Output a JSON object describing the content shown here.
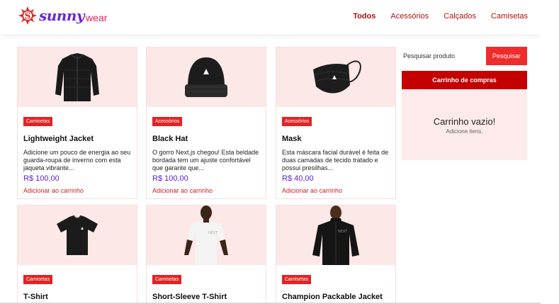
{
  "brand": {
    "name": "sunny",
    "suffix": "wear",
    "badge_letter": "S"
  },
  "nav": [
    {
      "label": "Todos",
      "active": true
    },
    {
      "label": "Acessórios",
      "active": false
    },
    {
      "label": "Calçados",
      "active": false
    },
    {
      "label": "Camisetas",
      "active": false
    }
  ],
  "products": [
    {
      "tag": "Camisetas",
      "name": "Lightweight Jacket",
      "desc": "Adicione um pouco de energia ao seu guarda-roupa de inverno com esta jaqueta vibrante...",
      "price": "R$ 100,00",
      "add": "Adicionar ao carrinho",
      "image": "jacket-icon"
    },
    {
      "tag": "Acessórios",
      "name": "Black Hat",
      "desc": "O gorro Next.js chegou! Esta beldade bordada tem um ajuste confortável que garante que...",
      "price": "R$ 100,00",
      "add": "Adicionar ao carrinho",
      "image": "beanie-icon"
    },
    {
      "tag": "Acessórios",
      "name": "Mask",
      "desc": "Esta máscara facial durável é feita de duas camadas de tecido tratado e possui presilhas...",
      "price": "R$ 40,00",
      "add": "Adicionar ao carrinho",
      "image": "mask-icon"
    },
    {
      "tag": "Camisetas",
      "name": "T-Shirt",
      "image": "tshirt-icon"
    },
    {
      "tag": "Camisetas",
      "name": "Short-Sleeve T-Shirt",
      "image": "model-tshirt-icon"
    },
    {
      "tag": "Camisetas",
      "name": "Champion Packable Jacket",
      "image": "model-jacket-icon"
    }
  ],
  "search": {
    "placeholder": "Pesquisar produto",
    "button": "Pesquisar"
  },
  "cart": {
    "title": "Carrinho de compras",
    "empty": "Carrinho vazio!",
    "hint": "Adicione itens."
  },
  "colors": {
    "accent": "#e02424",
    "brand_purple": "#6a27d9",
    "price": "#5b1fe0",
    "image_bg": "#fde8e8"
  }
}
